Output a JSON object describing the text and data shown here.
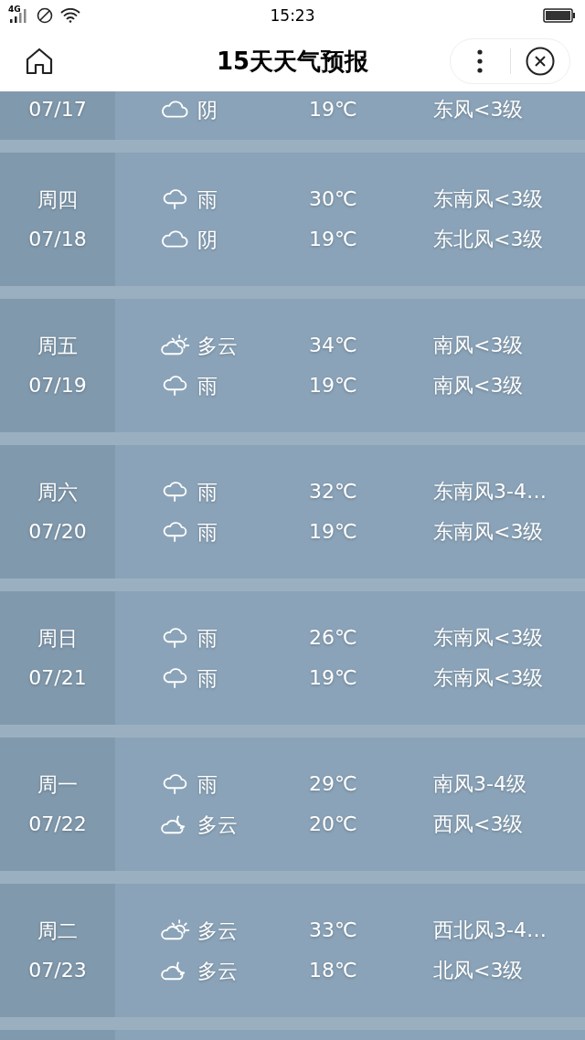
{
  "status_bar": {
    "network": "4G",
    "time": "15:23"
  },
  "header": {
    "title": "15天天气预报"
  },
  "partial_row": {
    "date": "07/17",
    "line": {
      "kind": "overcast",
      "label": "阴",
      "temp": "19℃",
      "wind": "东风<3级"
    }
  },
  "days": [
    {
      "day": "周四",
      "date": "07/18",
      "lines": [
        {
          "kind": "rain",
          "label": "雨",
          "temp": "30℃",
          "wind": "东南风<3级"
        },
        {
          "kind": "overcast",
          "label": "阴",
          "temp": "19℃",
          "wind": "东北风<3级"
        }
      ]
    },
    {
      "day": "周五",
      "date": "07/19",
      "lines": [
        {
          "kind": "cloudy-day",
          "label": "多云",
          "temp": "34℃",
          "wind": "南风<3级"
        },
        {
          "kind": "rain",
          "label": "雨",
          "temp": "19℃",
          "wind": "南风<3级"
        }
      ]
    },
    {
      "day": "周六",
      "date": "07/20",
      "lines": [
        {
          "kind": "rain",
          "label": "雨",
          "temp": "32℃",
          "wind": "东南风3-4…"
        },
        {
          "kind": "rain",
          "label": "雨",
          "temp": "19℃",
          "wind": "东南风<3级"
        }
      ]
    },
    {
      "day": "周日",
      "date": "07/21",
      "lines": [
        {
          "kind": "rain",
          "label": "雨",
          "temp": "26℃",
          "wind": "东南风<3级"
        },
        {
          "kind": "rain",
          "label": "雨",
          "temp": "19℃",
          "wind": "东南风<3级"
        }
      ]
    },
    {
      "day": "周一",
      "date": "07/22",
      "lines": [
        {
          "kind": "rain",
          "label": "雨",
          "temp": "29℃",
          "wind": "南风3-4级"
        },
        {
          "kind": "cloudy-night",
          "label": "多云",
          "temp": "20℃",
          "wind": "西风<3级"
        }
      ]
    },
    {
      "day": "周二",
      "date": "07/23",
      "lines": [
        {
          "kind": "cloudy-day",
          "label": "多云",
          "temp": "33℃",
          "wind": "西北风3-4…"
        },
        {
          "kind": "cloudy-night",
          "label": "多云",
          "temp": "18℃",
          "wind": "北风<3级"
        }
      ]
    }
  ]
}
